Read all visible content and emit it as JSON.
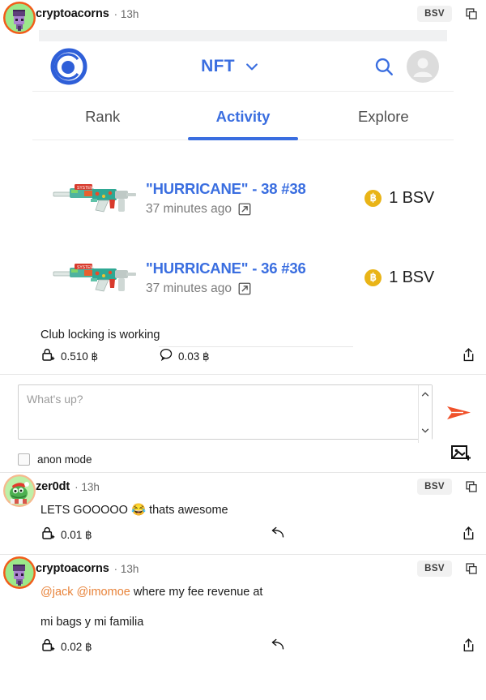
{
  "post": {
    "author": "cryptoacorns",
    "time": "· 13h",
    "badge": "BSV",
    "copy_icon": "copy-icon",
    "text": "Club locking is working",
    "lock_amount": "0.510 ฿",
    "comment_amount": "0.03 ฿",
    "lock_icon": "lock-plus-icon",
    "comment_icon": "speech-bubble-icon",
    "share_icon": "share-icon"
  },
  "nft_app": {
    "logo_icon": "relayx-swirl-logo-icon",
    "title": "NFT",
    "chevron_icon": "chevron-down-icon",
    "search_icon": "search-icon",
    "profile_icon": "profile-avatar-icon",
    "tabs": [
      {
        "label": "Rank",
        "active": false
      },
      {
        "label": "Activity",
        "active": true
      },
      {
        "label": "Explore",
        "active": false
      }
    ],
    "accent_color": "#3a6ee0",
    "items": [
      {
        "thumb_icon": "ak47-hurricane-skin-icon",
        "name": "\"HURRICANE\" - 38 #38",
        "time": "37 minutes ago",
        "external_icon": "external-link-icon",
        "coin_symbol": "฿",
        "price": "1 BSV"
      },
      {
        "thumb_icon": "ak47-hurricane-skin-icon",
        "name": "\"HURRICANE\" - 36 #36",
        "time": "37 minutes ago",
        "external_icon": "external-link-icon",
        "coin_symbol": "฿",
        "price": "1 BSV"
      }
    ]
  },
  "composer": {
    "placeholder": "What's up?",
    "value": "",
    "send_icon": "send-arrow-icon",
    "anon_label": "anon mode",
    "anon_checked": false,
    "image_icon": "add-image-icon",
    "scroll_up_icon": "chevron-up-icon",
    "scroll_down_icon": "chevron-down-icon"
  },
  "comments": [
    {
      "author": "zer0dt",
      "time": "· 13h",
      "badge": "BSV",
      "copy_icon": "copy-icon",
      "text": "LETS GOOOOO 😂 thats awesome",
      "lock_amount": "0.01 ฿",
      "lock_icon": "lock-plus-icon",
      "reply_icon": "reply-arrow-icon",
      "share_icon": "share-icon",
      "mentions": "",
      "text2": ""
    },
    {
      "author": "cryptoacorns",
      "time": "· 13h",
      "badge": "BSV",
      "copy_icon": "copy-icon",
      "mentions": "@jack @imomoe",
      "text": " where my fee revenue at",
      "text2": "mi bags y mi familia",
      "lock_amount": "0.02 ฿",
      "lock_icon": "lock-plus-icon",
      "reply_icon": "reply-arrow-icon",
      "share_icon": "share-icon"
    }
  ],
  "colors": {
    "accent_blue": "#3a6ee0",
    "orange": "#f04e23",
    "mention_orange": "#e8833a",
    "coin_gold": "#e9b417"
  }
}
